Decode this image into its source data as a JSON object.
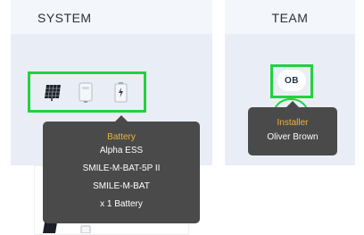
{
  "system": {
    "title": "SYSTEM"
  },
  "team": {
    "title": "TEAM"
  },
  "battery_tooltip": {
    "label": "Battery",
    "lines": [
      "Alpha ESS",
      "SMILE-M-BAT-5P II",
      "SMILE-M-BAT",
      "x 1 Battery"
    ]
  },
  "installer_tooltip": {
    "label": "Installer",
    "name": "Oliver Brown"
  },
  "avatar": {
    "initials": "OB"
  },
  "colors": {
    "highlight": "#22d13f",
    "tooltip_bg": "#4a4a4a",
    "tooltip_label": "#f0b43a",
    "card_bg": "#e9eef6"
  },
  "icons": [
    "solar-panel-icon",
    "inverter-icon",
    "battery-icon"
  ]
}
